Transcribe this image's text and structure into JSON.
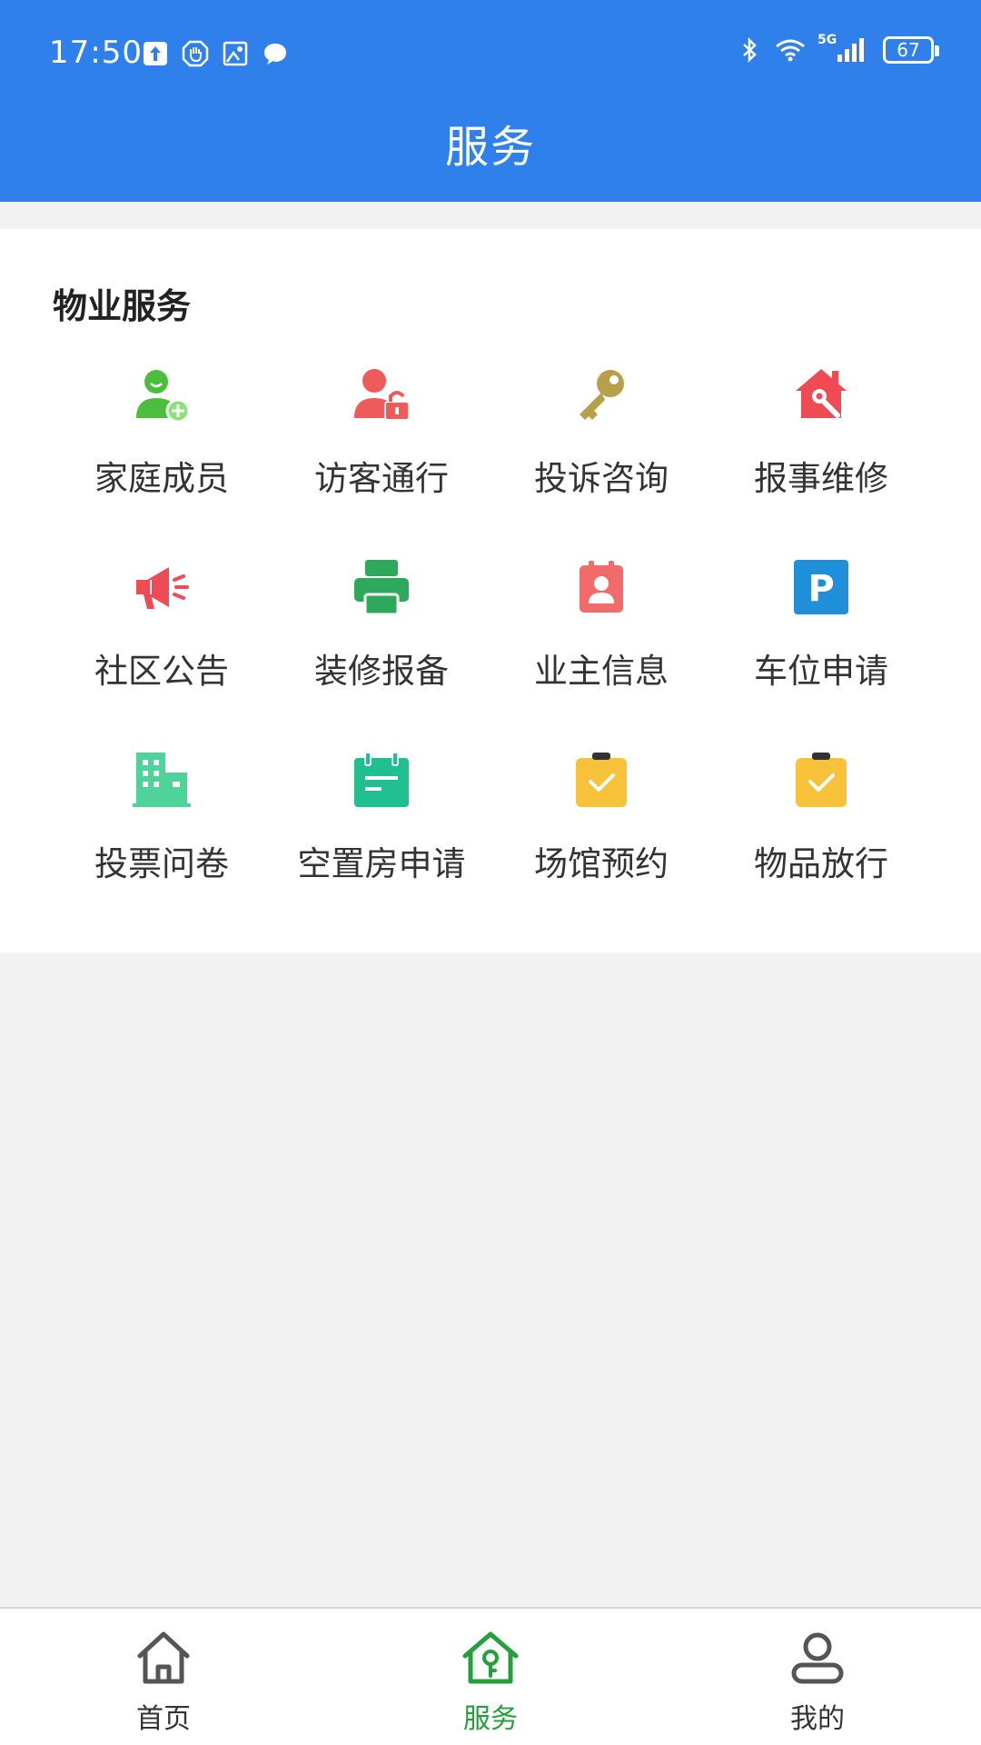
{
  "status_bar": {
    "time": "17:50",
    "battery": "67",
    "network": "5G",
    "left_icons": [
      "upload-icon",
      "hand-shield-icon",
      "image-alert-icon",
      "chat-bubble-icon"
    ],
    "right_icons": [
      "bluetooth-icon",
      "wifi-icon",
      "signal-icon",
      "battery-icon"
    ]
  },
  "header": {
    "title": "服务"
  },
  "section": {
    "title": "物业服务",
    "items": [
      {
        "label": "家庭成员",
        "icon": "user-add-icon",
        "color": "#4cbe3d"
      },
      {
        "label": "访客通行",
        "icon": "user-lock-icon",
        "color": "#ef5a5a"
      },
      {
        "label": "投诉咨询",
        "icon": "key-icon",
        "color": "#b8a04a"
      },
      {
        "label": "报事维修",
        "icon": "house-wrench-icon",
        "color": "#ef4b55"
      },
      {
        "label": "社区公告",
        "icon": "megaphone-icon",
        "color": "#ef4b55"
      },
      {
        "label": "装修报备",
        "icon": "printer-icon",
        "color": "#2ea85a"
      },
      {
        "label": "业主信息",
        "icon": "owner-card-icon",
        "color": "#f26b6b"
      },
      {
        "label": "车位申请",
        "icon": "parking-icon",
        "color": "#1e8fd8"
      },
      {
        "label": "投票问卷",
        "icon": "building-icon",
        "color": "#4fd39a"
      },
      {
        "label": "空置房申请",
        "icon": "calendar-icon",
        "color": "#1fbf8f"
      },
      {
        "label": "场馆预约",
        "icon": "clipboard-check-icon",
        "color": "#f7c23a"
      },
      {
        "label": "物品放行",
        "icon": "clipboard-check-icon",
        "color": "#f7c23a"
      }
    ]
  },
  "tabbar": {
    "tabs": [
      {
        "label": "首页",
        "icon": "home-icon",
        "active": false
      },
      {
        "label": "服务",
        "icon": "house-key-icon",
        "active": true
      },
      {
        "label": "我的",
        "icon": "user-icon",
        "active": false
      }
    ],
    "active_color": "#24a03a"
  },
  "colors": {
    "header": "#2f80ea",
    "background": "#f2f2f2"
  }
}
